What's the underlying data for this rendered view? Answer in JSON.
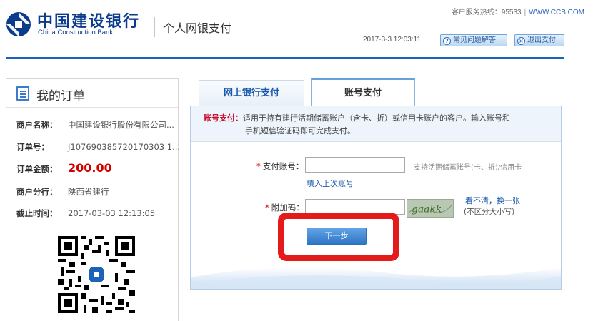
{
  "header": {
    "bank_name_cn": "中国建设银行",
    "bank_name_en": "China Construction Bank",
    "service_title": "个人网银支付",
    "hotline_label": "客户服务热线：95533",
    "website": "WWW.CCB.COM",
    "datetime": "2017-3-3 12:03:11",
    "help_button": "常见问题解答",
    "exit_button": "退出支付",
    "brand_color": "#0b3b8c",
    "bar_color": "#1c63b7"
  },
  "order": {
    "title": "我的订单",
    "merchant_label": "商户名称：",
    "merchant_value": "中国建设银行股份有限公司...",
    "order_no_label": "订单号：",
    "order_no_value": "J107690385720170303 1...",
    "amount_label": "订单金额：",
    "amount_value": "200.00",
    "branch_label": "商户分行：",
    "branch_value": "陕西省建行",
    "deadline_label": "截止时间：",
    "deadline_value": "2017-03-03 12:13:05"
  },
  "tabs": {
    "bank": "网上银行支付",
    "account": "账号支付"
  },
  "payment": {
    "desc_label": "账号支付：",
    "desc_line1": "适用于持有建行活期储蓄账户（含卡、折）或信用卡账户的客户。输入账号和",
    "desc_line2": "手机短信验证码即可完成支付。",
    "account_label": "支付账号：",
    "account_value": "",
    "account_hint": "支持活期储蓄账号(卡、折)/信用卡",
    "fill_last_link": "填入上次账号",
    "captcha_label": "附加码：",
    "captcha_value": "",
    "captcha_text": "gaakk",
    "refresh_link": "看不清，换一张",
    "case_hint": "(不区分大小写)",
    "next_button": "下一步",
    "highlight_color": "#e31b1b"
  }
}
